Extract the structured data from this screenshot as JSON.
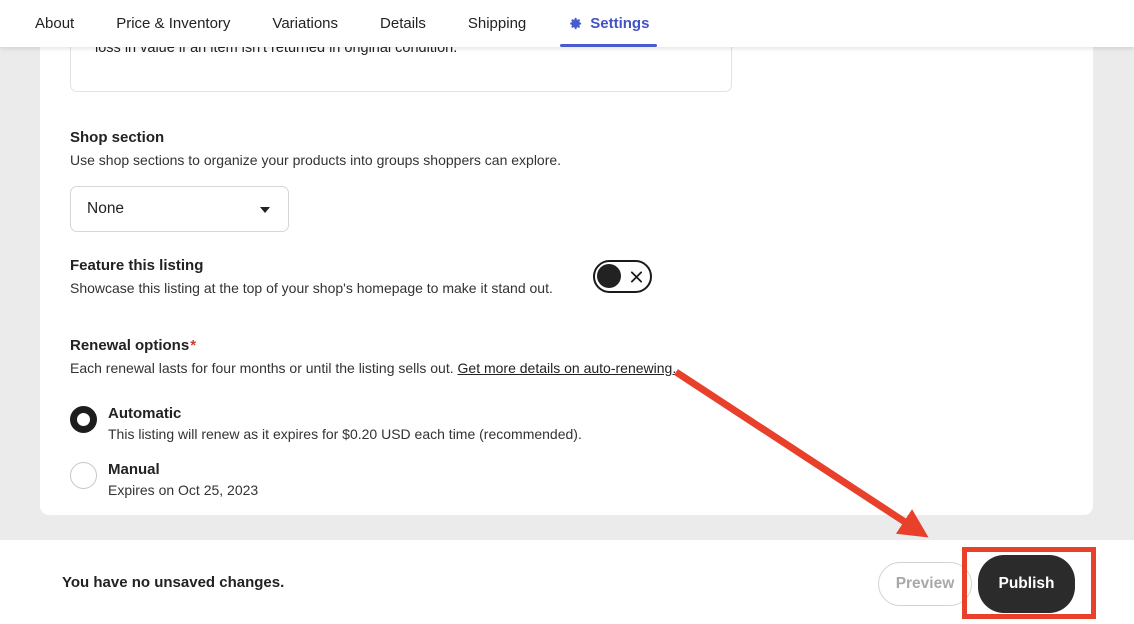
{
  "tabs": [
    {
      "label": "About",
      "icon": null,
      "active": false
    },
    {
      "label": "Price & Inventory",
      "icon": null,
      "active": false
    },
    {
      "label": "Variations",
      "icon": null,
      "active": false
    },
    {
      "label": "Details",
      "icon": null,
      "active": false
    },
    {
      "label": "Shipping",
      "icon": null,
      "active": false
    },
    {
      "label": "Settings",
      "icon": "gear-icon",
      "active": true
    }
  ],
  "card": {
    "policy_text": "loss in value if an item isn't returned in original condition.",
    "shop_section": {
      "title": "Shop section",
      "description": "Use shop sections to organize your products into groups shoppers can explore.",
      "select_value": "None",
      "caret_icon": "chevron-down-icon"
    },
    "feature_listing": {
      "title": "Feature this listing",
      "description": "Showcase this listing at the top of your shop's homepage to make it stand out.",
      "toggle_state": "off",
      "toggle_icon": "close-x-icon"
    },
    "renewal_options": {
      "title": "Renewal options",
      "required_marker": "*",
      "description": "Each renewal lasts for four months or until the listing sells out.",
      "link_text": "Get more details on auto-renewing.",
      "options": [
        {
          "label": "Automatic",
          "description": "This listing will renew as it expires for $0.20 USD each time (recommended).",
          "selected": true
        },
        {
          "label": "Manual",
          "description": "Expires on Oct 25, 2023",
          "selected": false
        }
      ]
    }
  },
  "footer": {
    "status_text": "You have no unsaved changes.",
    "preview_label": "Preview",
    "publish_label": "Publish"
  },
  "colors": {
    "accent_blue": "#4a5ccd",
    "annotation_red": "#e8402a",
    "required_red": "#cc3b2f",
    "publish_dark": "#2b2b2b",
    "page_grey": "#ebebeb"
  }
}
